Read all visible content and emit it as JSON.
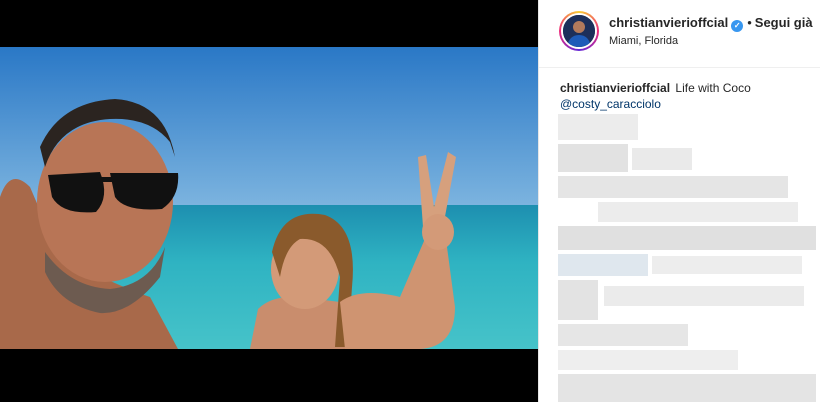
{
  "post": {
    "username": "christianvierioffcial",
    "follow_label": "Segui già",
    "separator": "•",
    "location": "Miami, Florida"
  },
  "caption": {
    "username": "christianvierioffcial",
    "text": "Life with Coco",
    "mention": "@costy_caracciolo"
  },
  "icons": {
    "verified": "verified-badge-icon"
  },
  "colors": {
    "accent": "#3897f0",
    "mention": "#003569",
    "text": "#262626",
    "ocean": "#2aa7b8",
    "sky": "#2f7fc8"
  }
}
